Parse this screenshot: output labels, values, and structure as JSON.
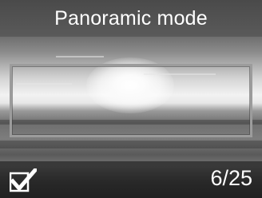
{
  "header": {
    "title": "Panoramic mode"
  },
  "footer": {
    "select_icon": "checkmark-icon",
    "counter": "6/25"
  }
}
